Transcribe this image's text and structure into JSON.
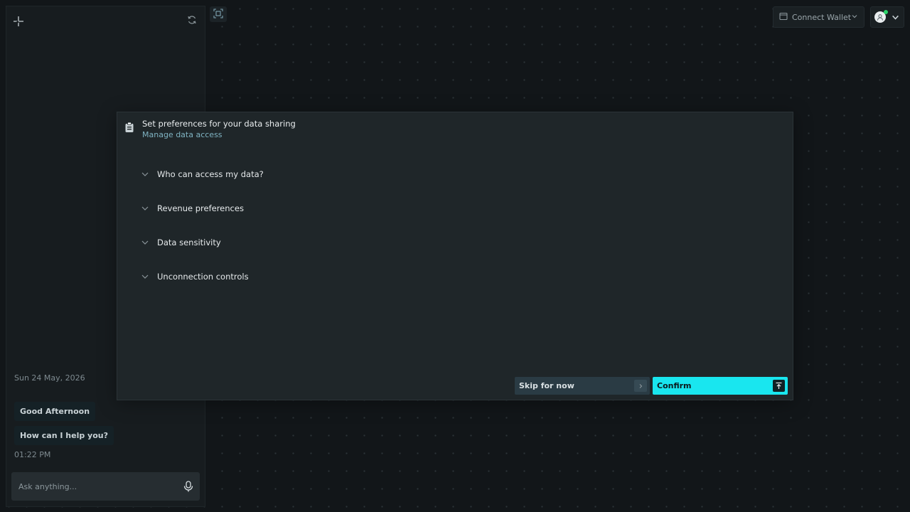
{
  "sidebar": {
    "logo_icon": "sparkle-icon",
    "refresh_icon": "refresh-icon",
    "chat": {
      "date": "Sun 24 May, 2026",
      "messages": [
        {
          "text": "Good Afternoon"
        },
        {
          "text": "How can I help you?"
        }
      ],
      "time": "01:22 PM"
    },
    "input": {
      "placeholder": "Ask anything...",
      "value": "",
      "mic_icon": "microphone-icon"
    }
  },
  "toolbar": {
    "scan_icon": "scan-icon",
    "wallet_label": "Connect Wallet",
    "wallet_icon": "wallet-icon",
    "profile_icon": "avatar-icon",
    "status_color": "#2bd46a"
  },
  "modal": {
    "icon": "clipboard-icon",
    "title": "Set preferences for your data sharing",
    "subtitle": "Manage data access",
    "sections": [
      {
        "label": "Who can access my data?"
      },
      {
        "label": "Revenue preferences"
      },
      {
        "label": "Data sensitivity"
      },
      {
        "label": "Unconnection controls"
      }
    ],
    "skip_label": "Skip for now",
    "confirm_label": "Confirm"
  },
  "colors": {
    "accent": "#19e6ef",
    "background": "#121619",
    "panel": "#1f2629"
  }
}
